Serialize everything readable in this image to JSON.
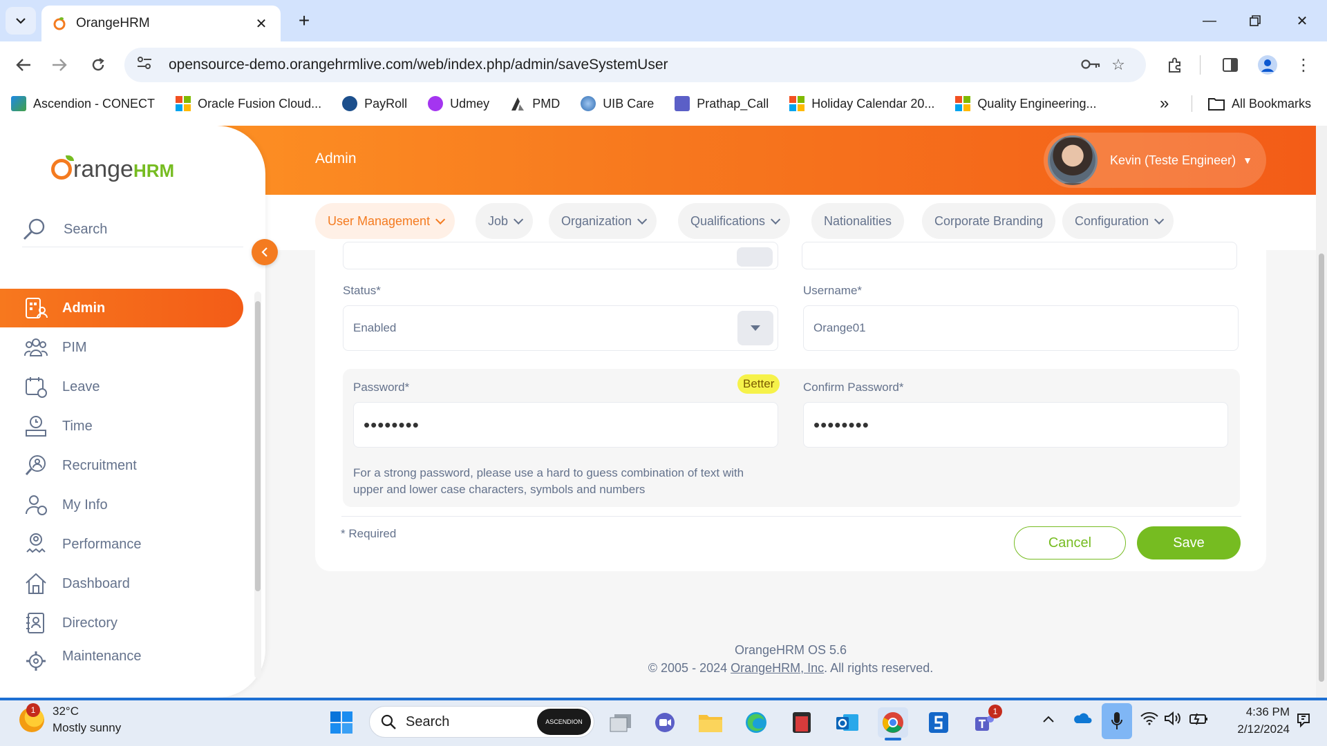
{
  "browser": {
    "tab_title": "OrangeHRM",
    "url": "opensource-demo.orangehrmlive.com/web/index.php/admin/saveSystemUser",
    "bookmarks": [
      {
        "label": "Ascendion - CONECT",
        "icon": "ascendion-icon"
      },
      {
        "label": "Oracle Fusion Cloud...",
        "icon": "microsoft-icon"
      },
      {
        "label": "PayRoll",
        "icon": "payroll-icon"
      },
      {
        "label": "Udmey",
        "icon": "udemy-icon"
      },
      {
        "label": "PMD",
        "icon": "pmd-icon"
      },
      {
        "label": "UIB Care",
        "icon": "uib-icon"
      },
      {
        "label": "Prathap_Call",
        "icon": "teams-icon"
      },
      {
        "label": "Holiday Calendar 20...",
        "icon": "microsoft-icon"
      },
      {
        "label": "Quality Engineering...",
        "icon": "microsoft-icon"
      }
    ],
    "more_bookmarks": "»",
    "all_bookmarks": "All Bookmarks"
  },
  "app": {
    "logo_text_1": "range",
    "logo_text_2": "HRM",
    "topbar_title": "Admin",
    "user_name": "Kevin (Teste Engineer)",
    "search_label": "Search",
    "sidebar": [
      {
        "label": "Admin",
        "icon": "admin-icon",
        "active": true
      },
      {
        "label": "PIM",
        "icon": "pim-icon"
      },
      {
        "label": "Leave",
        "icon": "leave-icon"
      },
      {
        "label": "Time",
        "icon": "time-icon"
      },
      {
        "label": "Recruitment",
        "icon": "recruitment-icon"
      },
      {
        "label": "My Info",
        "icon": "my-info-icon"
      },
      {
        "label": "Performance",
        "icon": "performance-icon"
      },
      {
        "label": "Dashboard",
        "icon": "dashboard-icon"
      },
      {
        "label": "Directory",
        "icon": "directory-icon"
      },
      {
        "label": "Maintenance",
        "icon": "maintenance-icon"
      }
    ],
    "subnav": [
      {
        "label": "User Management",
        "dropdown": true,
        "active": true
      },
      {
        "label": "Job",
        "dropdown": true
      },
      {
        "label": "Organization",
        "dropdown": true
      },
      {
        "label": "Qualifications",
        "dropdown": true
      },
      {
        "label": "Nationalities",
        "dropdown": false
      },
      {
        "label": "Corporate Branding",
        "dropdown": false
      },
      {
        "label": "Configuration",
        "dropdown": true
      }
    ],
    "help": "?"
  },
  "form": {
    "status_label": "Status*",
    "status_value": "Enabled",
    "username_label": "Username*",
    "username_value": "Orange01",
    "password_label": "Password*",
    "password_strength": "Better",
    "password_value": "••••••••",
    "confirm_label": "Confirm Password*",
    "confirm_value": "••••••••",
    "hint_line1": "For a strong password, please use a hard to guess combination of text with",
    "hint_line2": "upper and lower case characters, symbols and numbers",
    "required_note": "* Required",
    "cancel": "Cancel",
    "save": "Save"
  },
  "footer": {
    "version": "OrangeHRM OS 5.6",
    "copyright_prefix": "© 2005 - 2024 ",
    "company_link": "OrangeHRM, Inc",
    "copyright_suffix": ". All rights reserved."
  },
  "taskbar": {
    "temperature": "32°C",
    "weather": "Mostly sunny",
    "weather_badge": "1",
    "search": "Search",
    "search_pill": "ASCENDION",
    "teams_badge": "1",
    "time": "4:36 PM",
    "date": "2/12/2024"
  },
  "colors": {
    "accent": "#f47b20",
    "green": "#76bc21",
    "text_muted": "#64728c"
  }
}
